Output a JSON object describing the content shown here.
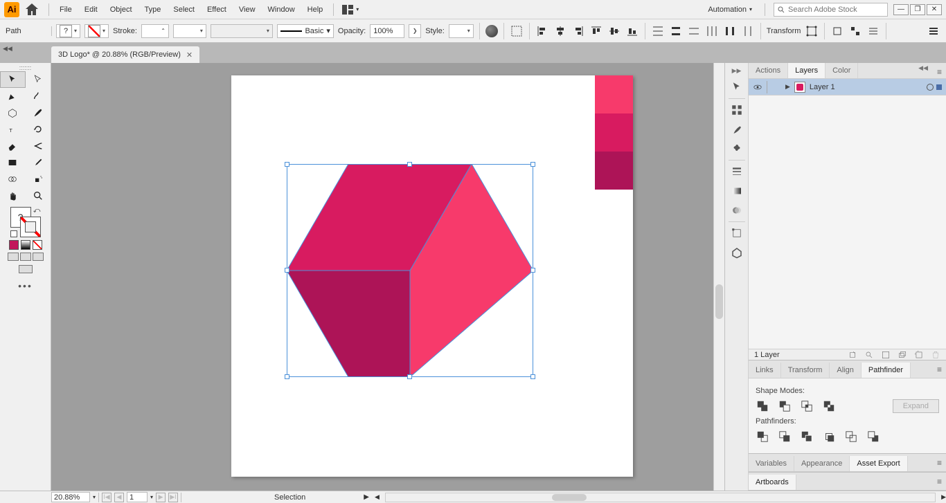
{
  "menu": {
    "items": [
      "File",
      "Edit",
      "Object",
      "Type",
      "Select",
      "Effect",
      "View",
      "Window",
      "Help"
    ],
    "workspace": "Automation",
    "search_ph": "Search Adobe Stock"
  },
  "ctrl": {
    "left_label": "Path",
    "fill_q": "?",
    "stroke_lbl": "Stroke:",
    "brush_lbl": "Basic",
    "opacity_lbl": "Opacity:",
    "opacity_val": "100%",
    "style_lbl": "Style:",
    "transform": "Transform"
  },
  "doc": {
    "tab": "3D Logo* @ 20.88% (RGB/Preview)"
  },
  "swatches": [
    "#f73a6b",
    "#d81b60",
    "#ad1457"
  ],
  "cube": {
    "top": "#d81b60",
    "right": "#f73a6b",
    "left": "#ad1457"
  },
  "fill_q": "?",
  "layers": {
    "tabs": [
      "Actions",
      "Layers",
      "Color"
    ],
    "active": 1,
    "row": "Layer 1",
    "footer": "1 Layer"
  },
  "midtabs": {
    "tabs": [
      "Links",
      "Transform",
      "Align",
      "Pathfinder"
    ],
    "active": 3,
    "shape_modes": "Shape Modes:",
    "pathfinders": "Pathfinders:",
    "expand": "Expand"
  },
  "bottabs": {
    "tabs": [
      "Variables",
      "Appearance",
      "Asset Export"
    ],
    "active": 2
  },
  "artboards_tab": "Artboards",
  "status": {
    "zoom": "20.88%",
    "art": "1",
    "tool": "Selection"
  }
}
